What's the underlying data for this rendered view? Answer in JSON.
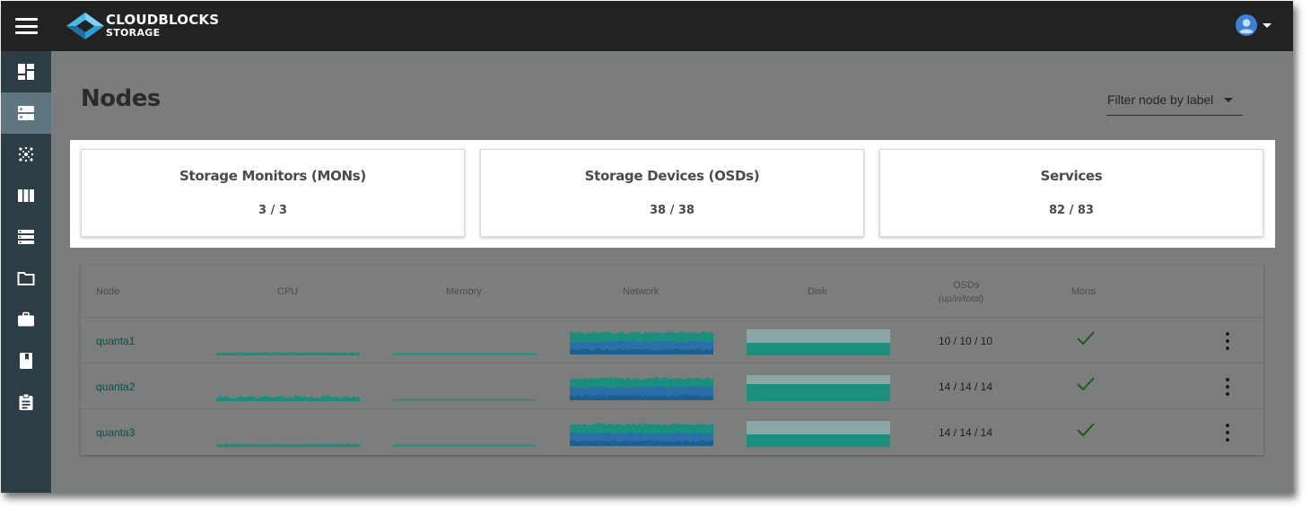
{
  "app": {
    "brand_line1": "CLOUDBLOCKS",
    "brand_line2": "STORAGE"
  },
  "icons": {
    "menu": "hamburger-menu-icon",
    "logo": "cloudblocks-logo-icon",
    "user": "user-avatar-icon",
    "user_menu": "caret-down-icon"
  },
  "sidebar": {
    "items": [
      {
        "icon": "dashboard-icon",
        "active": false
      },
      {
        "icon": "nodes-icon",
        "active": true
      },
      {
        "icon": "cluster-icon",
        "active": false
      },
      {
        "icon": "pools-icon",
        "active": false
      },
      {
        "icon": "list-icon",
        "active": false
      },
      {
        "icon": "folder-icon",
        "active": false
      },
      {
        "icon": "briefcase-icon",
        "active": false
      },
      {
        "icon": "book-icon",
        "active": false
      },
      {
        "icon": "clipboard-icon",
        "active": false
      }
    ]
  },
  "page": {
    "title": "Nodes",
    "filter_label": "Filter node by label"
  },
  "stats": [
    {
      "title": "Storage Monitors (MONs)",
      "value": "3 / 3"
    },
    {
      "title": "Storage Devices (OSDs)",
      "value": "38 / 38"
    },
    {
      "title": "Services",
      "value": "82 / 83"
    }
  ],
  "table": {
    "headers": {
      "node": "Node",
      "cpu": "CPU",
      "memory": "Memory",
      "network": "Network",
      "disk": "Disk",
      "osds": "OSDs",
      "osds_sub": "(up/in/total)",
      "mons": "Mons"
    },
    "rows": [
      {
        "node": "quanta1",
        "osds": "10 / 10 / 10",
        "mon": true
      },
      {
        "node": "quanta2",
        "osds": "14 / 14 / 14",
        "mon": true
      },
      {
        "node": "quanta3",
        "osds": "14 / 14 / 14",
        "mon": true
      }
    ]
  },
  "colors": {
    "topbar": "#222222",
    "sidebar": "#2c3d46",
    "sidebar_active": "#5f7580",
    "overlay": "#7b7c7c",
    "teal": "#1b8f7e",
    "blue": "#2b6fa8",
    "link": "#0d4d46",
    "check": "#1e5a1e"
  }
}
